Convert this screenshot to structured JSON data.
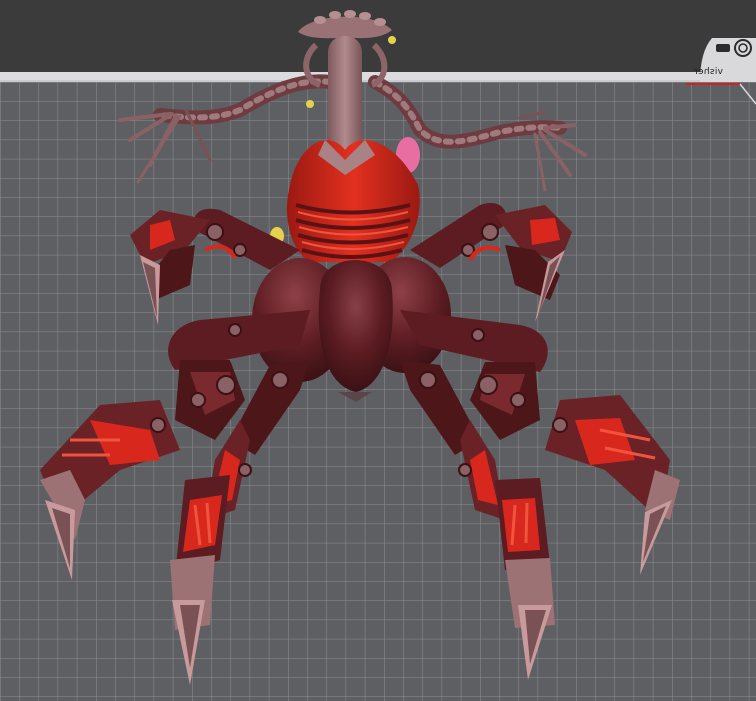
{
  "viewport": {
    "background_color": "#3b3b3b",
    "bed_color": "#5d5e61",
    "bed_border_color": "#d6d6d8",
    "grid_color": "#9a9b9e",
    "axis_color": "#cc2222"
  },
  "bed_logo": {
    "icon": "bed-logo-icon",
    "text": "ɹǝɥsᴉʌ"
  },
  "model": {
    "body_color": "#6a2226",
    "body_dark_color": "#451417",
    "accent_color": "#d8281e",
    "bone_color": "#9c7275",
    "tip_color": "#c89a9c",
    "highlight_pink": "#e86ea2",
    "highlight_yellow": "#e6d24a"
  }
}
